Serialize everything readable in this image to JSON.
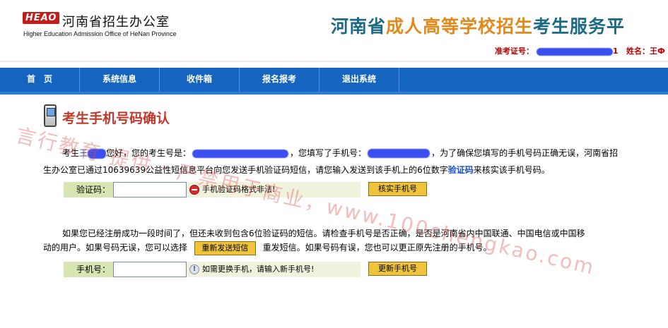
{
  "header": {
    "logo_badge": "HEAO",
    "logo_cn": "河南省招生办公室",
    "logo_en": "Higher Education Admission Office of HeNan Province",
    "title_part1": "河南省",
    "title_part2": "成人高等学校招生",
    "title_part3": "考生服务平",
    "ticket_label": "准考证号：",
    "ticket_suffix": "1",
    "name_label": "姓名：王Ф"
  },
  "nav": {
    "items": [
      {
        "label": "首　页"
      },
      {
        "label": "系统信息"
      },
      {
        "label": "收件箱"
      },
      {
        "label": "报名报考"
      },
      {
        "label": "退出系统"
      }
    ]
  },
  "section": {
    "title": "考生手机号码确认"
  },
  "paragraph1": {
    "greeting_prefix": "考生",
    "greeting_surname": "王",
    "greeting_suffix": "您好，您的考生号是：",
    "phone_text": "，您填写了手机号：",
    "rest_line1": "，为了确保您填写的手机号码正确无误，河南省招",
    "line2_before": "生办公室已通过10639639公益性短信息平台向您发送手机验证码短信，请您输入发送到该手机上的6位数字",
    "line2_link": "验证码",
    "line2_after": "来核实该手机号码。"
  },
  "verify_form": {
    "label": "验证码：",
    "value": "",
    "error_message": "手机验证码格式非法!",
    "button": "核实手机号"
  },
  "paragraph2": {
    "line1": "如果您已经注册成功一段时间了，但还未收到包含6位验证码的短信。请检查手机号是否正确，是否是河南省内中国联通、中国电信或中国移",
    "line2_before": "动的用户。如果号码无误，您可以选择",
    "resend_button": "重新发送短信",
    "line2_after": "重发短信。如果号码有误，您也可以更正原先注册的手机号。"
  },
  "phone_form": {
    "label": "手机号：",
    "value": "",
    "info_message": "如需更换手机，请输入新手机号!",
    "button": "更新手机号"
  },
  "watermark": {
    "text": "言行教育 提供 · 严禁用于商业，www.100chengkao.com"
  },
  "colors": {
    "nav_bg": "#1565c0",
    "title_red": "#c0392b",
    "button_yellow": "#f0c43a",
    "redact_blue": "#3b4ff0"
  }
}
